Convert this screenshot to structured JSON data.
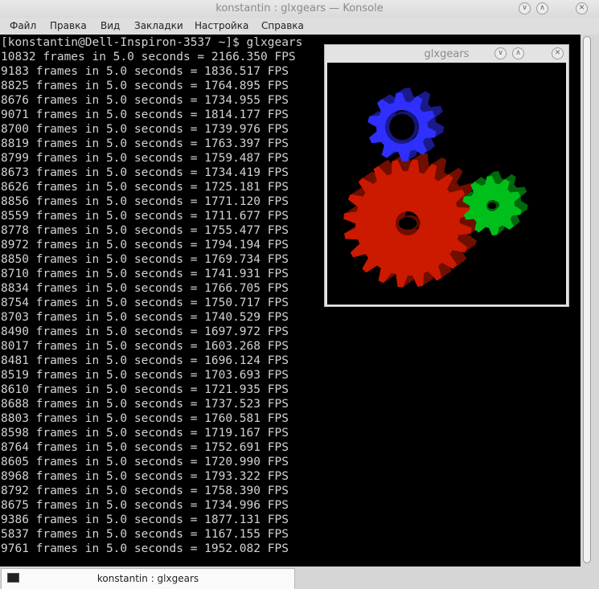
{
  "window": {
    "title": "konstantin : glxgears — Konsole"
  },
  "window_buttons": {
    "minimize": "∨",
    "maximize": "∧",
    "close": "✕"
  },
  "menu": [
    "Файл",
    "Правка",
    "Вид",
    "Закладки",
    "Настройка",
    "Справка"
  ],
  "terminal": {
    "lines": [
      "[konstantin@Dell-Inspiron-3537 ~]$ glxgears",
      "10832 frames in 5.0 seconds = 2166.350 FPS",
      "9183 frames in 5.0 seconds = 1836.517 FPS",
      "8825 frames in 5.0 seconds = 1764.895 FPS",
      "8676 frames in 5.0 seconds = 1734.955 FPS",
      "9071 frames in 5.0 seconds = 1814.177 FPS",
      "8700 frames in 5.0 seconds = 1739.976 FPS",
      "8819 frames in 5.0 seconds = 1763.397 FPS",
      "8799 frames in 5.0 seconds = 1759.487 FPS",
      "8673 frames in 5.0 seconds = 1734.419 FPS",
      "8626 frames in 5.0 seconds = 1725.181 FPS",
      "8856 frames in 5.0 seconds = 1771.120 FPS",
      "8559 frames in 5.0 seconds = 1711.677 FPS",
      "8778 frames in 5.0 seconds = 1755.477 FPS",
      "8972 frames in 5.0 seconds = 1794.194 FPS",
      "8850 frames in 5.0 seconds = 1769.734 FPS",
      "8710 frames in 5.0 seconds = 1741.931 FPS",
      "8834 frames in 5.0 seconds = 1766.705 FPS",
      "8754 frames in 5.0 seconds = 1750.717 FPS",
      "8703 frames in 5.0 seconds = 1740.529 FPS",
      "8490 frames in 5.0 seconds = 1697.972 FPS",
      "8017 frames in 5.0 seconds = 1603.268 FPS",
      "8481 frames in 5.0 seconds = 1696.124 FPS",
      "8519 frames in 5.0 seconds = 1703.693 FPS",
      "8610 frames in 5.0 seconds = 1721.935 FPS",
      "8688 frames in 5.0 seconds = 1737.523 FPS",
      "8803 frames in 5.0 seconds = 1760.581 FPS",
      "8598 frames in 5.0 seconds = 1719.167 FPS",
      "8764 frames in 5.0 seconds = 1752.691 FPS",
      "8605 frames in 5.0 seconds = 1720.990 FPS",
      "8968 frames in 5.0 seconds = 1793.322 FPS",
      "8792 frames in 5.0 seconds = 1758.390 FPS",
      "8675 frames in 5.0 seconds = 1734.996 FPS",
      "9386 frames in 5.0 seconds = 1877.131 FPS",
      "5837 frames in 5.0 seconds = 1167.155 FPS",
      "9761 frames in 5.0 seconds = 1952.082 FPS"
    ]
  },
  "glxgears": {
    "title": "glxgears"
  },
  "gears": [
    {
      "name": "red-gear",
      "color": "#cc1a00",
      "teeth": 20
    },
    {
      "name": "green-gear",
      "color": "#00bf1a",
      "teeth": 10
    },
    {
      "name": "blue-gear",
      "color": "#2f2fff",
      "teeth": 10
    }
  ],
  "tab": {
    "label": "konstantin : glxgears",
    "icon": "terminal-icon"
  },
  "colors": {
    "terminal_bg": "#000000",
    "terminal_fg": "#d3d3d3"
  }
}
